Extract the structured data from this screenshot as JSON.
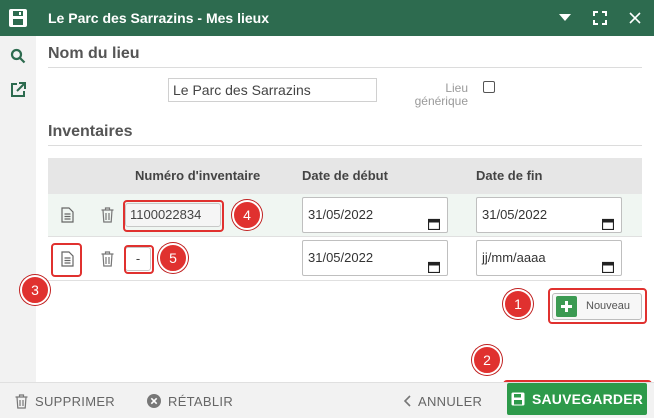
{
  "window": {
    "title": "Le Parc des Sarrazins - Mes lieux",
    "brand_color": "#2d6b4f",
    "accent_color": "#2d9a4a",
    "marker_color": "#e0312f"
  },
  "titlebar_icons": [
    "app-logo-icon",
    "dropdown-arrow-icon",
    "fullscreen-icon",
    "close-icon"
  ],
  "rail_icons": [
    "search-icon",
    "external-link-icon"
  ],
  "location": {
    "section_title": "Nom du lieu",
    "name_value": "Le Parc des Sarrazins",
    "generic_label_line1": "Lieu",
    "generic_label_line2": "générique",
    "generic_checked": false
  },
  "inventories": {
    "section_title": "Inventaires",
    "columns": {
      "number": "Numéro d'inventaire",
      "start": "Date de début",
      "end": "Date de fin"
    },
    "rows": [
      {
        "number": "1100022834",
        "start": "31/05/2022",
        "end": "31/05/2022"
      },
      {
        "number": "-",
        "start": "31/05/2022",
        "end": "jj/mm/aaaa"
      }
    ],
    "new_button": "Nouveau"
  },
  "markers": [
    "1",
    "2",
    "3",
    "4",
    "5"
  ],
  "footer": {
    "delete": "SUPPRIMER",
    "restore": "RÉTABLIR",
    "cancel": "ANNULER",
    "save": "SAUVEGARDER"
  }
}
